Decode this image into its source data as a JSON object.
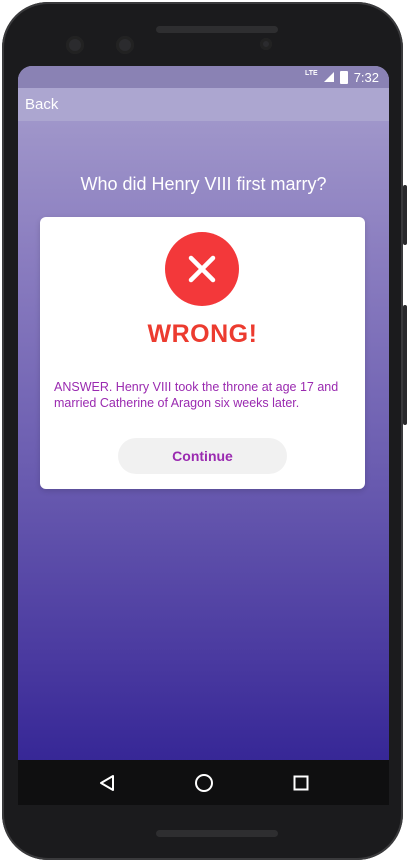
{
  "status_bar": {
    "network": "LTE",
    "time": "7:32"
  },
  "app_bar": {
    "back_label": "Back"
  },
  "quiz": {
    "question": "Who did Henry VIII first marry?"
  },
  "result_dialog": {
    "status_icon": "x-icon",
    "title": "WRONG!",
    "answer_text": "ANSWER. Henry VIII took the throne at age 17 and married Catherine of Aragon six weeks later.",
    "continue_label": "Continue",
    "colors": {
      "error_red": "#f3383a",
      "title_red": "#ec3b2f",
      "accent_purple": "#9a2ab0"
    }
  },
  "nav_bar": {
    "items": [
      "back-triangle-icon",
      "home-circle-icon",
      "recents-square-icon"
    ]
  }
}
